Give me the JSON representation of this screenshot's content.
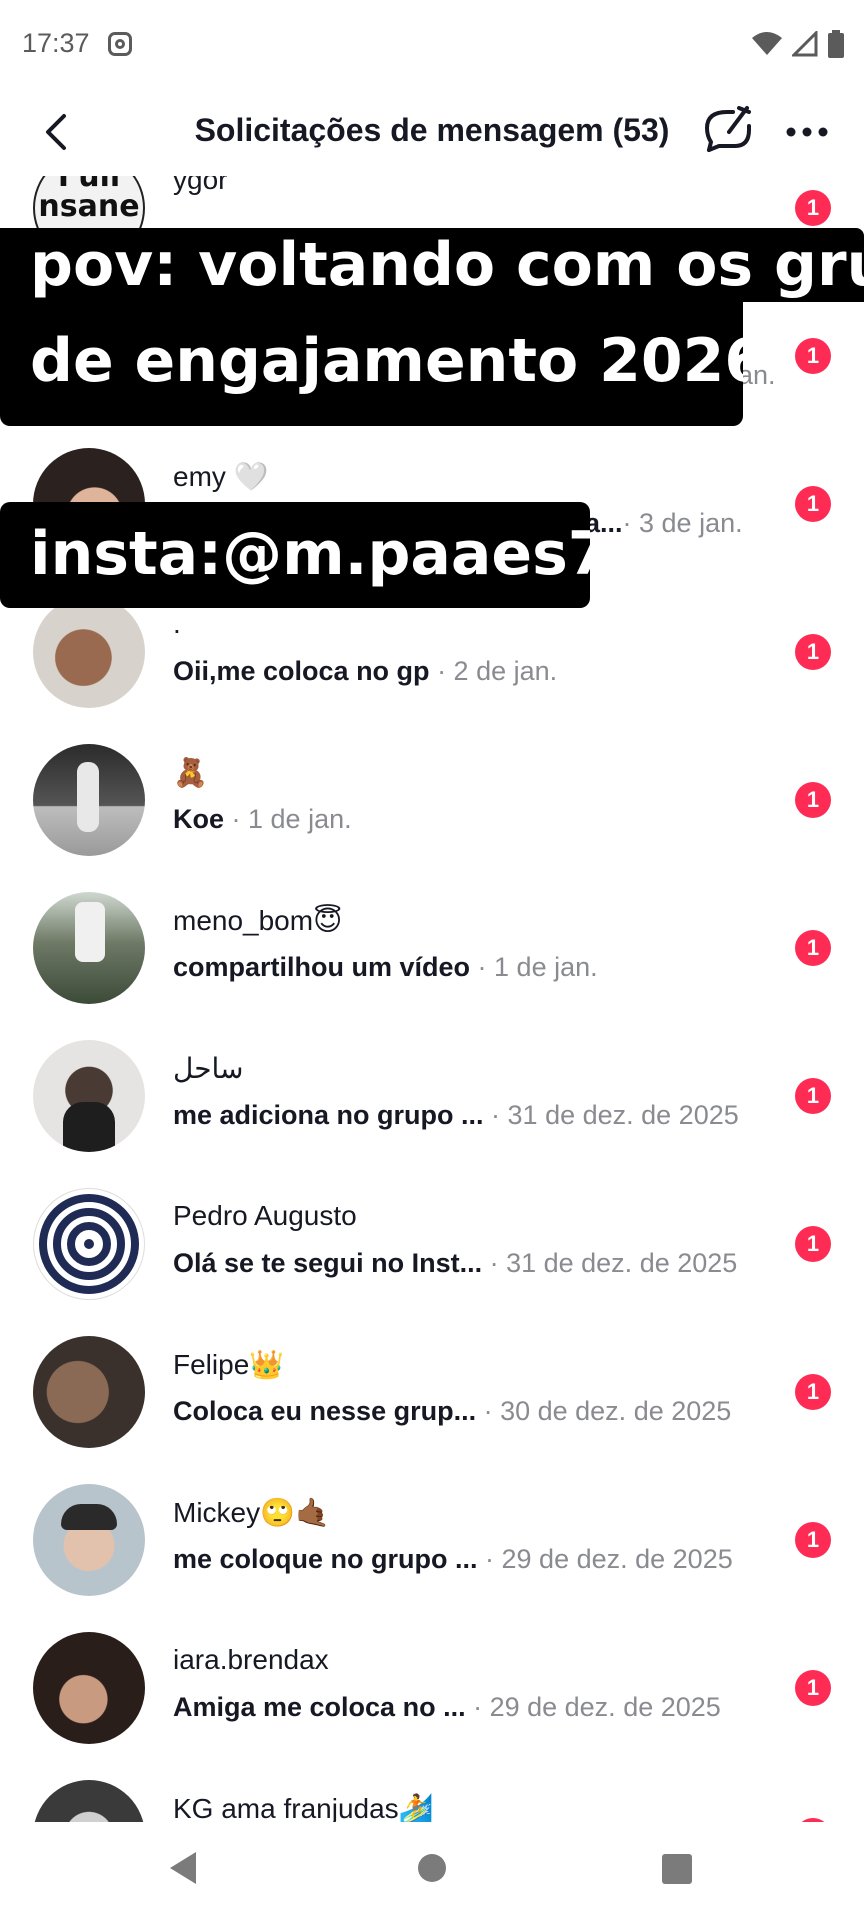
{
  "status_bar": {
    "time": "17:37"
  },
  "header": {
    "title": "Solicitações de mensagem (53)"
  },
  "conversations": [
    {
      "name": "ygor",
      "preview": "",
      "date": "",
      "badge": "1"
    },
    {
      "name": "",
      "preview": "",
      "date": "an.",
      "badge": "1"
    },
    {
      "name": "emy 🤍",
      "preview": "a...",
      "date": "· 3 de jan.",
      "badge": "1"
    },
    {
      "name": ".",
      "preview": "Oii,me coloca no gp",
      "date": "· 2 de jan.",
      "badge": "1"
    },
    {
      "name": "🧸",
      "preview": "Koe",
      "date": "· 1 de jan.",
      "badge": "1"
    },
    {
      "name": "meno_bom😇",
      "preview": "compartilhou um vídeo",
      "date": "· 1 de jan.",
      "badge": "1"
    },
    {
      "name": "ساحل",
      "preview": "me adiciona no grupo ...",
      "date": "· 31 de dez. de 2025",
      "badge": "1"
    },
    {
      "name": "Pedro Augusto",
      "preview": "Olá se te segui no Inst...",
      "date": "· 31 de dez. de 2025",
      "badge": "1"
    },
    {
      "name": "Felipe👑",
      "preview": "Coloca eu nesse grup...",
      "date": "· 30 de dez. de 2025",
      "badge": "1"
    },
    {
      "name": "Mickey🙄🤙🏾",
      "preview": "me coloque no grupo ...",
      "date": "· 29 de dez. de 2025",
      "badge": "1"
    },
    {
      "name": "iara.brendax",
      "preview": "Amiga me coloca no ...",
      "date": "· 29 de dez. de 2025",
      "badge": "1"
    },
    {
      "name": "KG ama franjudas🏄",
      "preview": "",
      "date": "",
      "badge": "1"
    }
  ],
  "overlay": {
    "line1": "pov: voltando com os grupos",
    "line2": "de engajamento 2026",
    "handle": "insta:@m.paaes7"
  },
  "colors": {
    "badge": "#fe2c55",
    "overlay_bg": "#000000"
  }
}
